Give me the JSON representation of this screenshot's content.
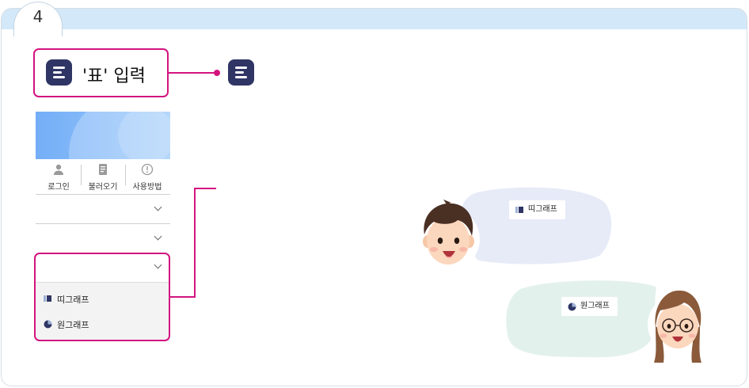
{
  "step": {
    "number": "4"
  },
  "callout": {
    "label": "'표' 입력",
    "menu_icon": "menu-lines-icon"
  },
  "panel": {
    "nav": [
      {
        "label": "로그인",
        "icon": "user-icon"
      },
      {
        "label": "불러오기",
        "icon": "document-icon"
      },
      {
        "label": "사용방법",
        "icon": "info-icon"
      }
    ],
    "dropdowns": [
      {
        "label": ""
      },
      {
        "label": ""
      },
      {
        "label": ""
      }
    ],
    "sub_items": [
      {
        "label": "띠그래프",
        "icon": "strip-graph-icon"
      },
      {
        "label": "원그래프",
        "icon": "pie-graph-icon"
      }
    ]
  },
  "bubbles": [
    {
      "label": "띠그래프",
      "icon": "strip-graph-icon",
      "color": "#e7ebf8",
      "speaker": "boy"
    },
    {
      "label": "원그래프",
      "icon": "pie-graph-icon",
      "color": "#e3f1ec",
      "speaker": "girl"
    }
  ],
  "colors": {
    "accent": "#d3147f",
    "header": "#d3e8f8",
    "menu_button": "#2f3564"
  }
}
